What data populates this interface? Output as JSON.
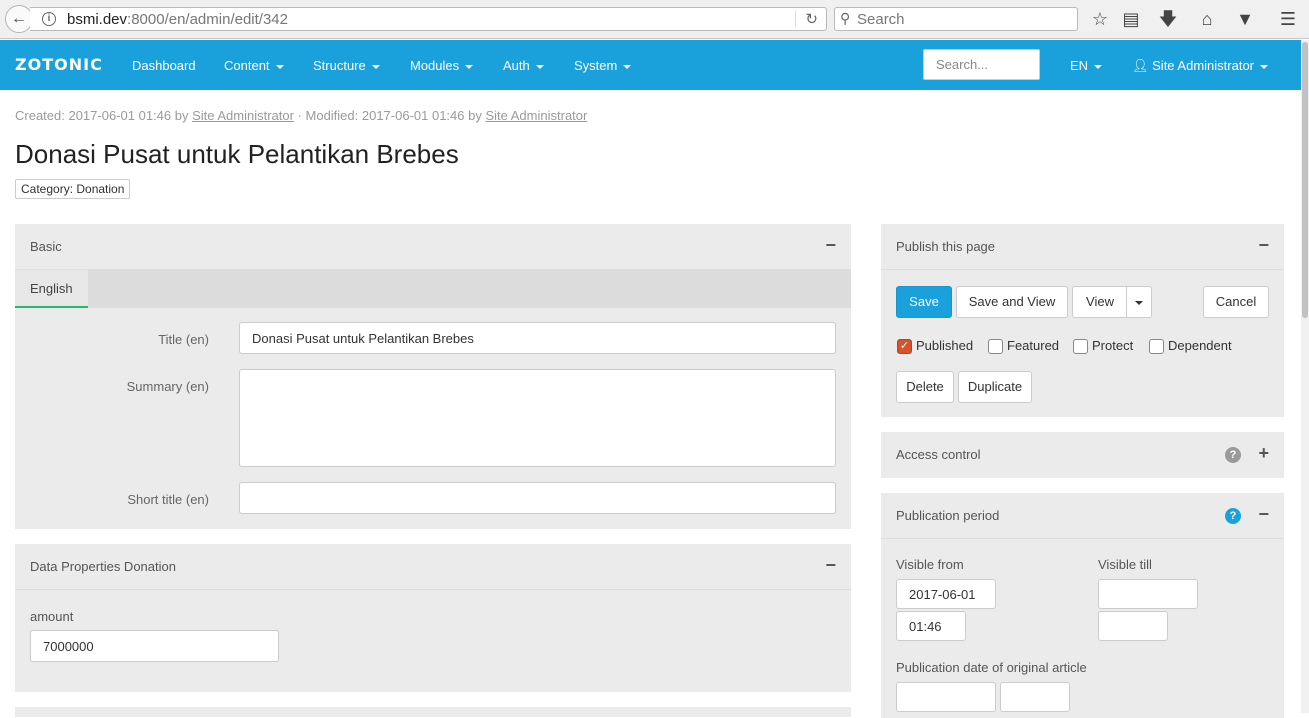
{
  "browser": {
    "url_host": "bsmi.dev",
    "url_rest": ":8000/en/admin/edit/342",
    "search_placeholder": "Search"
  },
  "nav": {
    "logo": "ZOTONIC",
    "items": [
      "Dashboard",
      "Content",
      "Structure",
      "Modules",
      "Auth",
      "System"
    ],
    "search_placeholder": "Search...",
    "language": "EN",
    "user": "Site Administrator",
    "accent_color": "#1aa1dc"
  },
  "header": {
    "created_prefix": "Created: 2017-06-01 01:46 by ",
    "created_by": "Site Administrator",
    "modified_prefix": " · Modified: 2017-06-01 01:46 by ",
    "modified_by": "Site Administrator",
    "title": "Donasi Pusat untuk Pelantikan Brebes",
    "category": "Category: Donation"
  },
  "basic": {
    "heading": "Basic",
    "tab": "English",
    "title_label": "Title (en)",
    "title_value": "Donasi Pusat untuk Pelantikan Brebes",
    "summary_label": "Summary (en)",
    "summary_value": "",
    "short_title_label": "Short title (en)",
    "short_title_value": ""
  },
  "data_props": {
    "heading": "Data Properties Donation",
    "amount_label": "amount",
    "amount_value": "7000000"
  },
  "publish": {
    "heading": "Publish this page",
    "save": "Save",
    "save_view": "Save and View",
    "view": "View",
    "cancel": "Cancel",
    "checks": [
      {
        "label": "Published",
        "checked": true
      },
      {
        "label": "Featured",
        "checked": false
      },
      {
        "label": "Protect",
        "checked": false
      },
      {
        "label": "Dependent",
        "checked": false
      }
    ],
    "delete": "Delete",
    "duplicate": "Duplicate"
  },
  "access": {
    "heading": "Access control",
    "help_icon": "question-icon",
    "toggle_icon": "plus-icon"
  },
  "pubperiod": {
    "heading": "Publication period",
    "visible_from_label": "Visible from",
    "visible_from_date": "2017-06-01",
    "visible_from_time": "01:46",
    "visible_till_label": "Visible till",
    "visible_till_date": "",
    "visible_till_time": "",
    "orig_label": "Publication date of original article",
    "orig_date": "",
    "orig_time": ""
  },
  "icons": {
    "collapse": "−",
    "expand": "+",
    "help": "?"
  }
}
